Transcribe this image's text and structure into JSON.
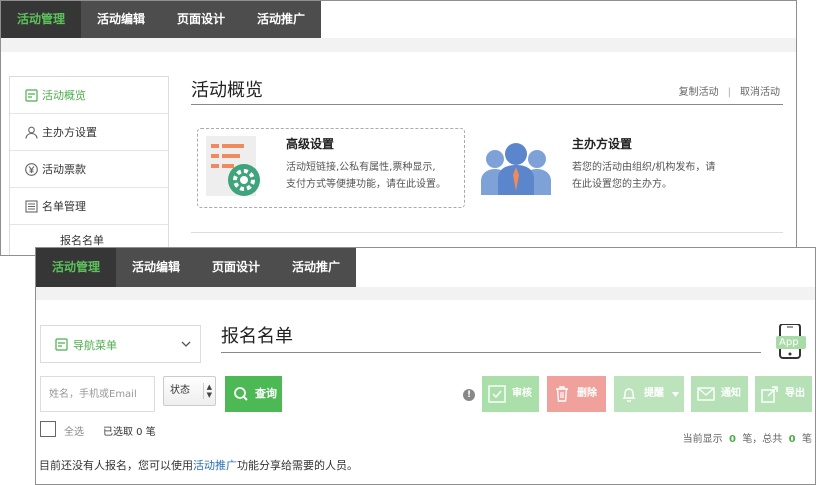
{
  "back_window": {
    "nav": [
      "活动管理",
      "活动编辑",
      "页面设计",
      "活动推广"
    ],
    "sidebar": [
      {
        "label": "活动概览",
        "icon": "activity-icon"
      },
      {
        "label": "主办方设置",
        "icon": "user-icon"
      },
      {
        "label": "活动票款",
        "icon": "yen-icon"
      },
      {
        "label": "名单管理",
        "icon": "list-icon"
      }
    ],
    "sidebar_sub": "报名名单",
    "title": "活动概览",
    "links": {
      "copy": "复制活动",
      "separator": "|",
      "cancel": "取消活动"
    },
    "card1": {
      "title": "高级设置",
      "desc1": "活动短链接,公私有属性,票种显示,",
      "desc2": "支付方式等便捷功能，请在此设置。"
    },
    "card2": {
      "title": "主办方设置",
      "desc1": "若您的活动由组织/机构发布，请",
      "desc2": "在此设置您的主办方。"
    }
  },
  "front_window": {
    "nav": [
      "活动管理",
      "活动编辑",
      "页面设计",
      "活动推广"
    ],
    "nav_select": "导航菜单",
    "title": "报名名单",
    "phone_badge": "App",
    "search_placeholder": "姓名，手机或Email",
    "status_label": "状态",
    "query": "查询",
    "info": "!",
    "actions": {
      "audit": "审核",
      "delete": "删除",
      "remind": "提醒",
      "notify": "通知",
      "export": "导出"
    },
    "select_all": "全选",
    "selected": "已选取 0 笔",
    "display": {
      "prefix": "当前显示",
      "shown": "0",
      "mid": "笔，总共",
      "total": "0",
      "suffix": "笔"
    },
    "empty": {
      "before": "目前还没有人报名，您可以使用",
      "link": "活动推广",
      "after": "功能分享给需要的人员。"
    }
  },
  "colors": {
    "nav_bg": "#4d4d4d",
    "nav_active_bg": "#363636",
    "accent_green": "#4cae4c",
    "query_green": "#4cb954",
    "audit": "#aadfaa",
    "delete": "#f0a19c",
    "remind": "#bde3bd",
    "notify": "#b6e1b6",
    "export": "#b6e1b6",
    "link_blue": "#2a6fb8"
  }
}
